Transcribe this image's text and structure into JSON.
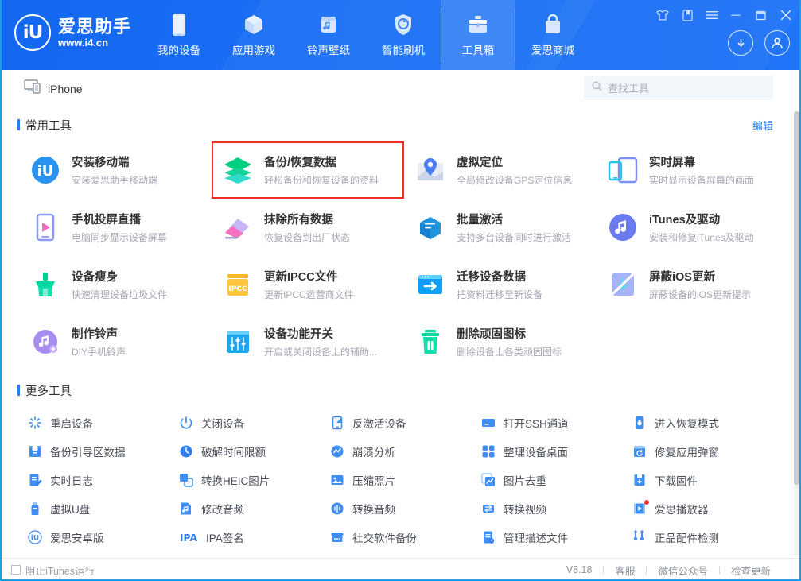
{
  "app": {
    "logo_mark": "iU",
    "logo_name": "爱思助手",
    "logo_url": "www.i4.cn"
  },
  "header": {
    "nav": [
      {
        "label": "我的设备",
        "icon": "phone-icon",
        "active": false
      },
      {
        "label": "应用游戏",
        "icon": "cube-icon",
        "active": false
      },
      {
        "label": "铃声壁纸",
        "icon": "music-folder-icon",
        "active": false
      },
      {
        "label": "智能刷机",
        "icon": "shield-refresh-icon",
        "active": false
      },
      {
        "label": "工具箱",
        "icon": "toolbox-icon",
        "active": true
      },
      {
        "label": "爱思商城",
        "icon": "shopping-bag-icon",
        "active": false
      }
    ],
    "window_controls": [
      {
        "name": "skin-icon",
        "title": "换肤"
      },
      {
        "name": "bookmark-icon",
        "title": "收藏"
      },
      {
        "name": "menu-icon",
        "title": "菜单"
      },
      {
        "name": "minimize-icon",
        "title": "最小化"
      },
      {
        "name": "maximize-icon",
        "title": "最大化"
      },
      {
        "name": "close-icon",
        "title": "关闭"
      }
    ],
    "round_buttons": [
      {
        "name": "download-icon",
        "title": "下载"
      },
      {
        "name": "account-icon",
        "title": "账号"
      }
    ],
    "accent_color": "#1a6ff5"
  },
  "subbar": {
    "device_label": "iPhone",
    "device_icon": "device-monitor-icon",
    "search_placeholder": "查找工具",
    "search_value": "",
    "search_icon": "search-icon"
  },
  "sections": {
    "common": {
      "title": "常用工具",
      "edit_label": "编辑",
      "cards": [
        {
          "title": "安装移动端",
          "sub": "安装爱思助手移动端",
          "icon": "i4-logo-icon",
          "highlight": false
        },
        {
          "title": "备份/恢复数据",
          "sub": "轻松备份和恢复设备的资料",
          "icon": "layers-icon",
          "highlight": true
        },
        {
          "title": "虚拟定位",
          "sub": "全局修改设备GPS定位信息",
          "icon": "map-pin-icon",
          "highlight": false
        },
        {
          "title": "实时屏幕",
          "sub": "实时显示设备屏幕的画面",
          "icon": "screen-mirror-icon",
          "highlight": false
        },
        {
          "title": "手机投屏直播",
          "sub": "电脑同步显示设备屏幕",
          "icon": "play-phone-icon",
          "highlight": false
        },
        {
          "title": "抹除所有数据",
          "sub": "恢复设备到出厂状态",
          "icon": "eraser-icon",
          "highlight": false
        },
        {
          "title": "批量激活",
          "sub": "支持多台设备同时进行激活",
          "icon": "box-activate-icon",
          "highlight": false
        },
        {
          "title": "iTunes及驱动",
          "sub": "安装和修复iTunes及驱动",
          "icon": "itunes-icon",
          "highlight": false
        },
        {
          "title": "设备瘦身",
          "sub": "快速清理设备垃圾文件",
          "icon": "broom-icon",
          "highlight": false
        },
        {
          "title": "更新IPCC文件",
          "sub": "更新IPCC运营商文件",
          "icon": "ipcc-folder-icon",
          "highlight": false
        },
        {
          "title": "迁移设备数据",
          "sub": "把资料迁移至新设备",
          "icon": "migrate-arrow-icon",
          "highlight": false
        },
        {
          "title": "屏蔽iOS更新",
          "sub": "屏蔽设备的iOS更新提示",
          "icon": "block-update-icon",
          "highlight": false
        },
        {
          "title": "制作铃声",
          "sub": "DIY手机铃声",
          "icon": "ringtone-add-icon",
          "highlight": false
        },
        {
          "title": "设备功能开关",
          "sub": "开启或关闭设备上的辅助...",
          "icon": "sliders-icon",
          "highlight": false
        },
        {
          "title": "删除顽固图标",
          "sub": "删除设备上各类顽固图标",
          "icon": "trash-icon",
          "highlight": false
        }
      ]
    },
    "more": {
      "title": "更多工具",
      "items": [
        {
          "label": "重启设备",
          "icon": "restart-icon",
          "badge": false
        },
        {
          "label": "关闭设备",
          "icon": "power-icon",
          "badge": false
        },
        {
          "label": "反激活设备",
          "icon": "deactivate-icon",
          "badge": false
        },
        {
          "label": "打开SSH通道",
          "icon": "ssh-icon",
          "badge": false
        },
        {
          "label": "进入恢复模式",
          "icon": "recovery-icon",
          "badge": false
        },
        {
          "label": "备份引导区数据",
          "icon": "backup-boot-icon",
          "badge": false
        },
        {
          "label": "破解时间限额",
          "icon": "clock-icon",
          "badge": false
        },
        {
          "label": "崩溃分析",
          "icon": "crash-analysis-icon",
          "badge": false
        },
        {
          "label": "整理设备桌面",
          "icon": "grid-apps-icon",
          "badge": false
        },
        {
          "label": "修复应用弹窗",
          "icon": "fix-popup-icon",
          "badge": false
        },
        {
          "label": "实时日志",
          "icon": "log-icon",
          "badge": false
        },
        {
          "label": "转换HEIC图片",
          "icon": "heic-convert-icon",
          "badge": false
        },
        {
          "label": "压缩照片",
          "icon": "compress-photo-icon",
          "badge": false
        },
        {
          "label": "图片去重",
          "icon": "dedupe-photo-icon",
          "badge": false
        },
        {
          "label": "下载固件",
          "icon": "firmware-download-icon",
          "badge": false
        },
        {
          "label": "虚拟U盘",
          "icon": "usb-icon",
          "badge": false
        },
        {
          "label": "修改音频",
          "icon": "edit-audio-icon",
          "badge": false
        },
        {
          "label": "转换音频",
          "icon": "convert-audio-icon",
          "badge": false
        },
        {
          "label": "转换视频",
          "icon": "convert-video-icon",
          "badge": false
        },
        {
          "label": "爱思播放器",
          "icon": "player-icon",
          "badge": true
        },
        {
          "label": "爱思安卓版",
          "icon": "i4-android-icon",
          "badge": false
        },
        {
          "label": "IPA签名",
          "icon": "ipa-sign-icon",
          "badge": false
        },
        {
          "label": "社交软件备份",
          "icon": "social-backup-icon",
          "badge": false
        },
        {
          "label": "管理描述文件",
          "icon": "profile-manage-icon",
          "badge": false
        },
        {
          "label": "正品配件检测",
          "icon": "accessory-check-icon",
          "badge": false
        }
      ]
    }
  },
  "statusbar": {
    "block_itunes_label": "阻止iTunes运行",
    "block_itunes_checked": false,
    "version": "V8.18",
    "links": [
      "客服",
      "微信公众号",
      "检查更新"
    ]
  }
}
